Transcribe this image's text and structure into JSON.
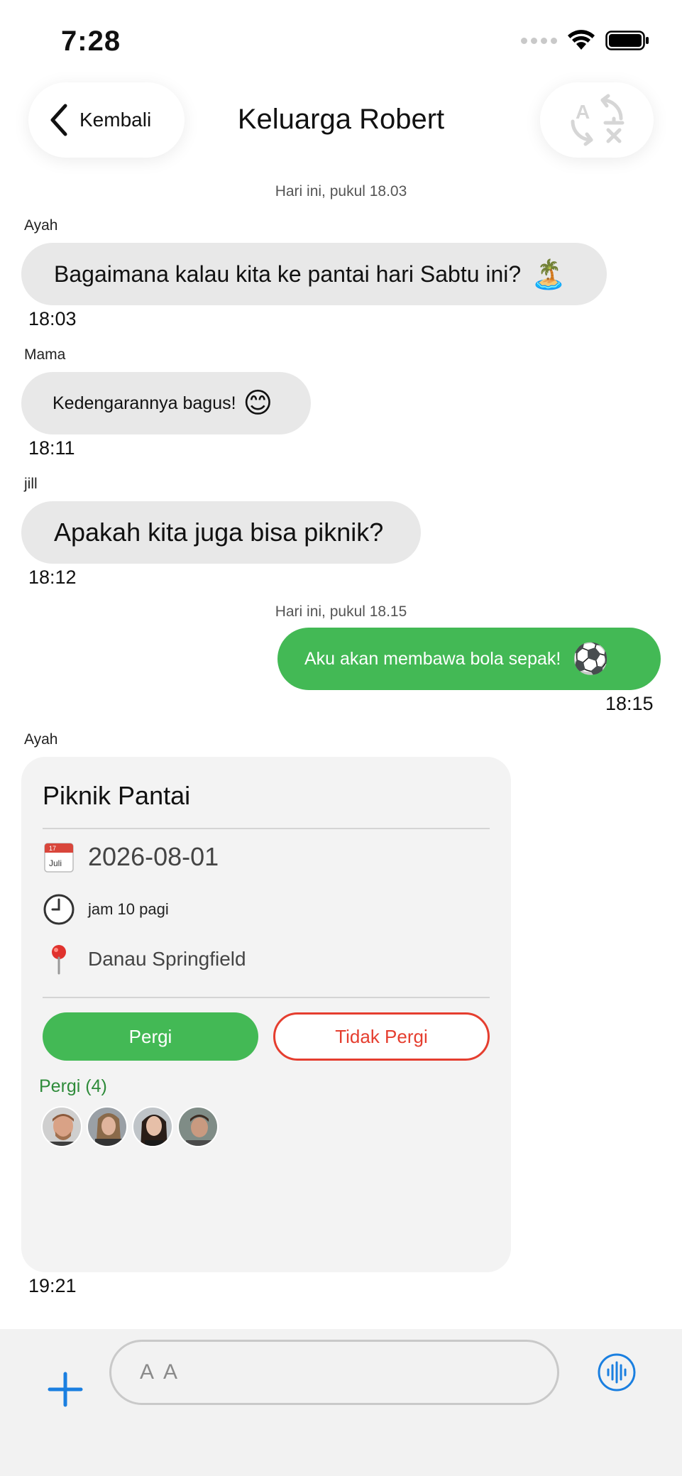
{
  "status_bar": {
    "time": "7:28"
  },
  "header": {
    "back_label": "Kembali",
    "title": "Keluarga Robert",
    "translate_icon": "translate-icon"
  },
  "messages": [
    {
      "day_label": "Hari ini, pukul 18.03"
    },
    {
      "sender": "Ayah",
      "text": "Bagaimana kalau kita ke pantai hari Sabtu ini?",
      "emoji": "🏝️",
      "time": "18:03"
    },
    {
      "sender": "Mama",
      "text": "Kedengarannya bagus!",
      "emoji": "😊",
      "time": "18:11"
    },
    {
      "sender": "jill",
      "text": "Apakah kita juga bisa piknik?",
      "time": "18:12"
    },
    {
      "day_label": "Hari ini, pukul 18.15"
    },
    {
      "sender": "",
      "text": "Aku akan membawa bola sepak!",
      "emoji": "⚽",
      "time": "18:15",
      "outgoing": true
    }
  ],
  "event": {
    "sender": "Ayah",
    "title": "Piknik Pantai",
    "calendar_month": "Juli",
    "calendar_day": "17",
    "date": "2026-08-01",
    "time": "jam 10 pagi",
    "location": "Danau Springfield",
    "go_label": "Pergi",
    "not_go_label": "Tidak Pergi",
    "going_label": "Pergi (4)",
    "timestamp": "19:21"
  },
  "composer": {
    "placeholder": "A A"
  },
  "colors": {
    "accent_green": "#43b955",
    "decline_red": "#e53e2f",
    "going_green": "#2e8b3a",
    "icon_blue": "#1a7fe0"
  }
}
